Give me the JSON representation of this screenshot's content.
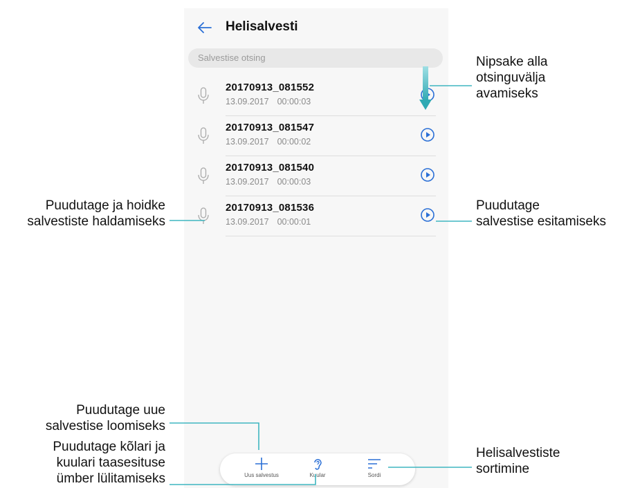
{
  "app": {
    "title": "Helisalvesti",
    "search_placeholder": "Salvestise otsing"
  },
  "recordings": [
    {
      "name": "20170913_081552",
      "date": "13.09.2017",
      "duration": "00:00:03"
    },
    {
      "name": "20170913_081547",
      "date": "13.09.2017",
      "duration": "00:00:02"
    },
    {
      "name": "20170913_081540",
      "date": "13.09.2017",
      "duration": "00:00:03"
    },
    {
      "name": "20170913_081536",
      "date": "13.09.2017",
      "duration": "00:00:01"
    }
  ],
  "bottom_bar": {
    "new_label": "Uus salvestus",
    "earpiece_label": "Kuular",
    "sort_label": "Sordi"
  },
  "annotations": {
    "swipe": [
      "Nipsake alla",
      "otsinguvälja",
      "avamiseks"
    ],
    "play": [
      "Puudutage",
      "salvestise esitamiseks"
    ],
    "hold": [
      "Puudutage ja hoidke",
      "salvestiste haldamiseks"
    ],
    "new": [
      "Puudutage uue",
      "salvestise loomiseks"
    ],
    "earpiece": [
      "Puudutage kõlari ja",
      "kuulari taasesituse",
      "ümber lülitamiseks"
    ],
    "sort": [
      "Helisalvestiste",
      "sortimine"
    ]
  },
  "colors": {
    "accent": "#2a6fd6",
    "callout_line": "#3fb6c0",
    "icon_gray": "#aaaaaa"
  }
}
